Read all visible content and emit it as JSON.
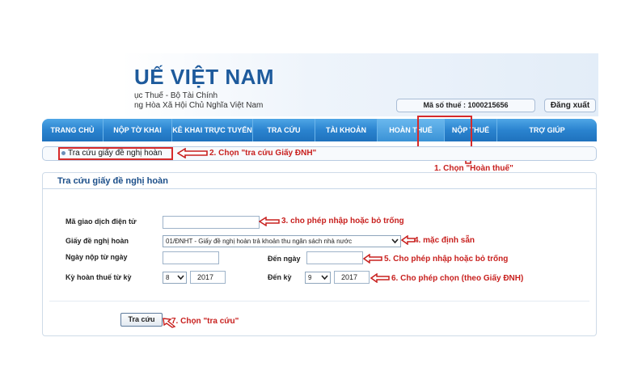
{
  "header": {
    "title": "UẾ VIỆT NAM",
    "subtitle1": "ục Thuế - Bộ Tài Chính",
    "subtitle2": "ng Hòa Xã Hội Chủ Nghĩa Việt Nam",
    "tax_code": "Mã số thuế : 1000215656",
    "logout": "Đăng xuất"
  },
  "nav": {
    "items": [
      {
        "label": "TRANG CHỦ"
      },
      {
        "label": "NỘP TỜ KHAI"
      },
      {
        "label": "KÊ KHAI TRỰC TUYẾN"
      },
      {
        "label": "TRA CỨU"
      },
      {
        "label": "TÀI KHOẢN"
      },
      {
        "label": "HOÀN THUẾ"
      },
      {
        "label": "NỘP THUẾ"
      },
      {
        "label": "TRỢ GIÚP"
      }
    ],
    "active": "HOÀN THUẾ"
  },
  "breadcrumb": {
    "item": "Tra cứu giấy đề nghị hoàn"
  },
  "panel": {
    "title": "Tra cứu giấy đề nghị hoàn",
    "fields": {
      "transaction_code_label": "Mã giao dịch điện tử",
      "transaction_code_value": "",
      "request_type_label": "Giấy đề nghị hoàn",
      "request_type_value": "01/ĐNHT - Giấy đề nghị hoàn trả khoản thu ngân sách nhà nước",
      "from_date_label": "Ngày nộp từ ngày",
      "from_date_value": "",
      "to_date_label": "Đến ngày",
      "to_date_value": "",
      "period_from_label": "Kỳ hoàn thuế từ kỳ",
      "period_from_month": "8",
      "period_from_year": "2017",
      "period_to_label": "Đến kỳ",
      "period_to_month": "9",
      "period_to_year": "2017"
    },
    "search_button": "Tra cứu"
  },
  "annotations": {
    "a1": "1. Chọn \"Hoàn thuế\"",
    "a2": "2. Chọn \"tra cứu Giấy ĐNH\"",
    "a3": "3. cho phép nhập hoặc bỏ trống",
    "a4": "4. mặc định sẵn",
    "a5": "5. Cho phép nhập hoặc bỏ trống",
    "a6": "6. Cho phép chọn (theo Giấy ĐNH)",
    "a7": "7. Chọn \"tra cứu\""
  },
  "colors": {
    "nav_blue": "#2a83cf",
    "brand_blue": "#1d5a9c",
    "annotation_red": "#c8201e"
  }
}
